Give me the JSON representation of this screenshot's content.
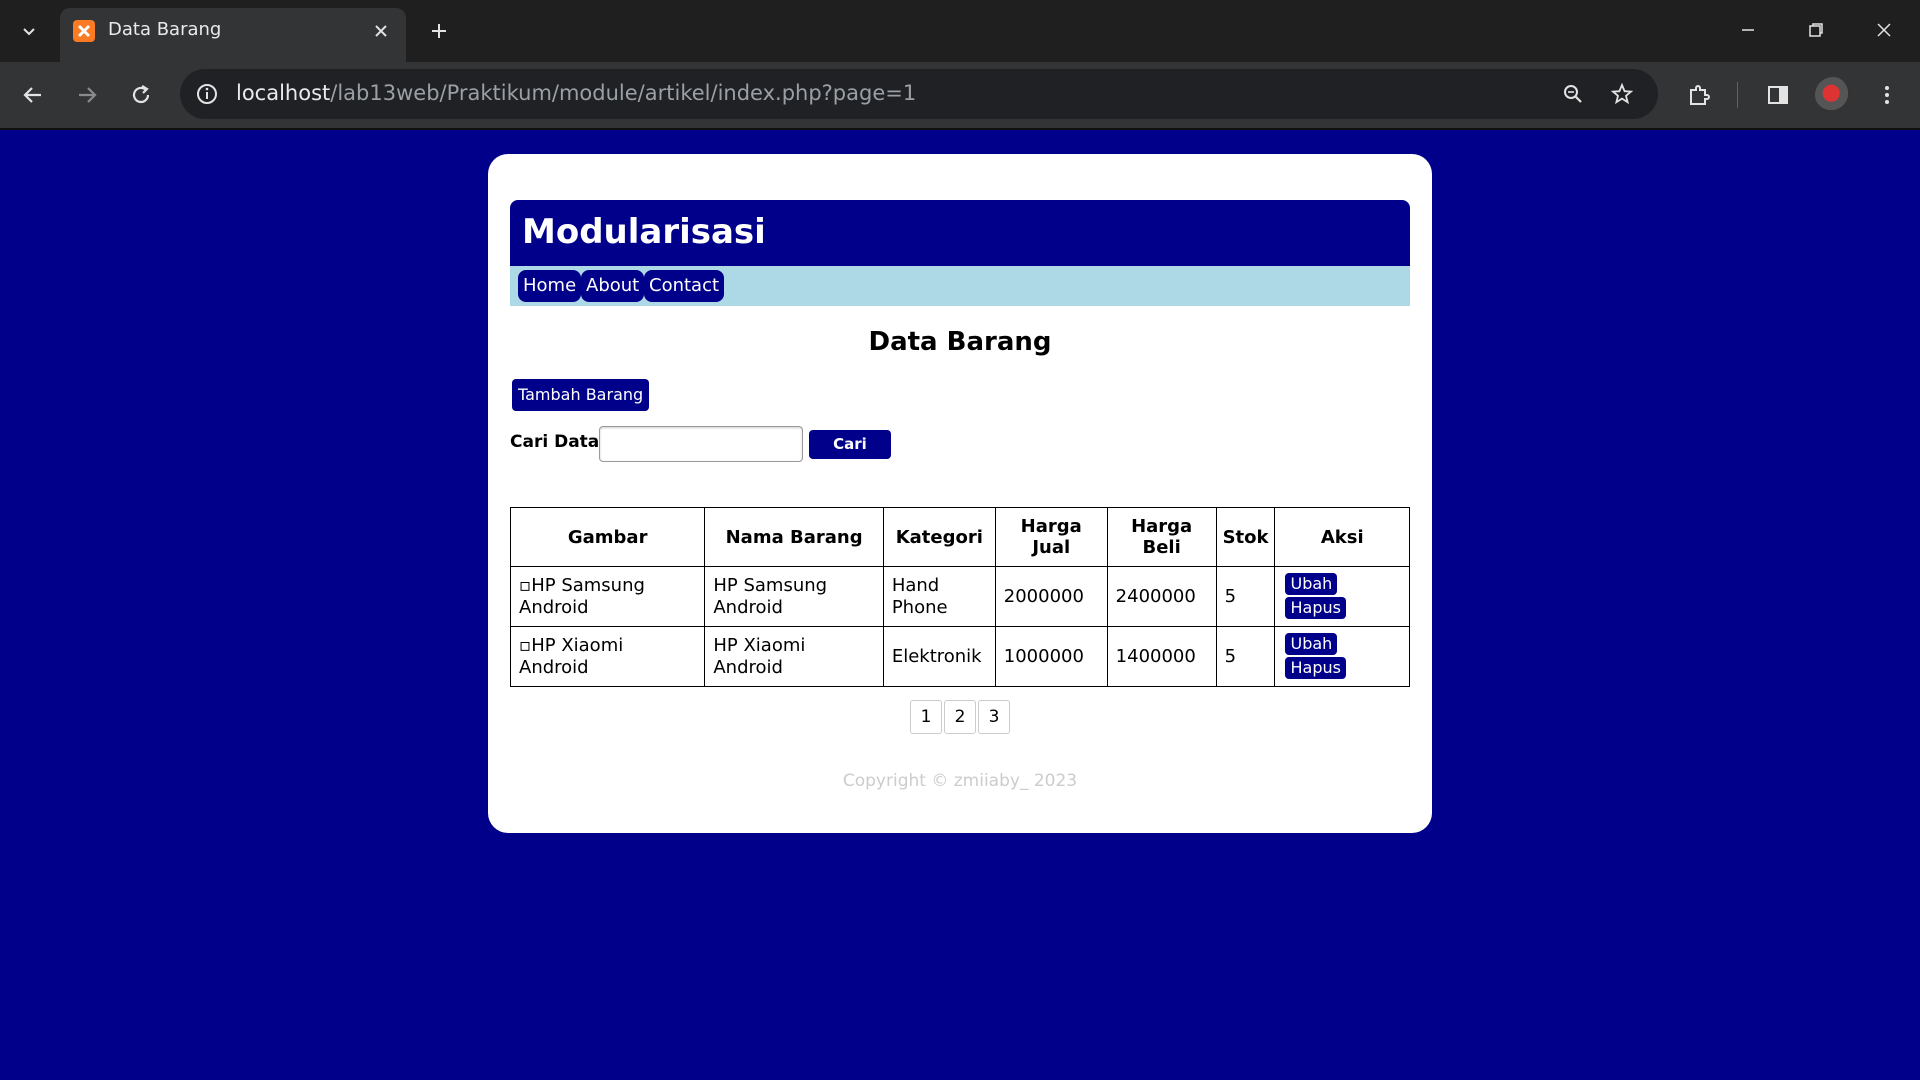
{
  "browser": {
    "tab_title": "Data Barang",
    "url_host": "localhost",
    "url_path": "/lab13web/Praktikum/module/artikel/index.php?page=1"
  },
  "page": {
    "site_title": "Modularisasi",
    "nav": [
      "Home",
      "About",
      "Contact"
    ],
    "heading": "Data Barang",
    "add_button": "Tambah Barang",
    "search_label": "Cari Data:",
    "search_value": "",
    "search_button": "Cari",
    "table": {
      "headers": [
        "Gambar",
        "Nama Barang",
        "Kategori",
        "Harga Jual",
        "Harga Beli",
        "Stok",
        "Aksi"
      ],
      "rows": [
        {
          "gambar_alt": "HP Samsung Android",
          "nama": "HP Samsung Android",
          "kategori": "Hand Phone",
          "harga_jual": "2000000",
          "harga_beli": "2400000",
          "stok": "5",
          "edit": "Ubah",
          "delete": "Hapus"
        },
        {
          "gambar_alt": "HP Xiaomi Android",
          "nama": "HP Xiaomi Android",
          "kategori": "Elektronik",
          "harga_jual": "1000000",
          "harga_beli": "1400000",
          "stok": "5",
          "edit": "Ubah",
          "delete": "Hapus"
        }
      ]
    },
    "pagination": [
      "1",
      "2",
      "3"
    ],
    "footer": "Copyright © zmiiaby_ 2023"
  },
  "colors": {
    "page_background": "#00008b",
    "nav_bar": "#add8e6",
    "button": "#00008b"
  }
}
